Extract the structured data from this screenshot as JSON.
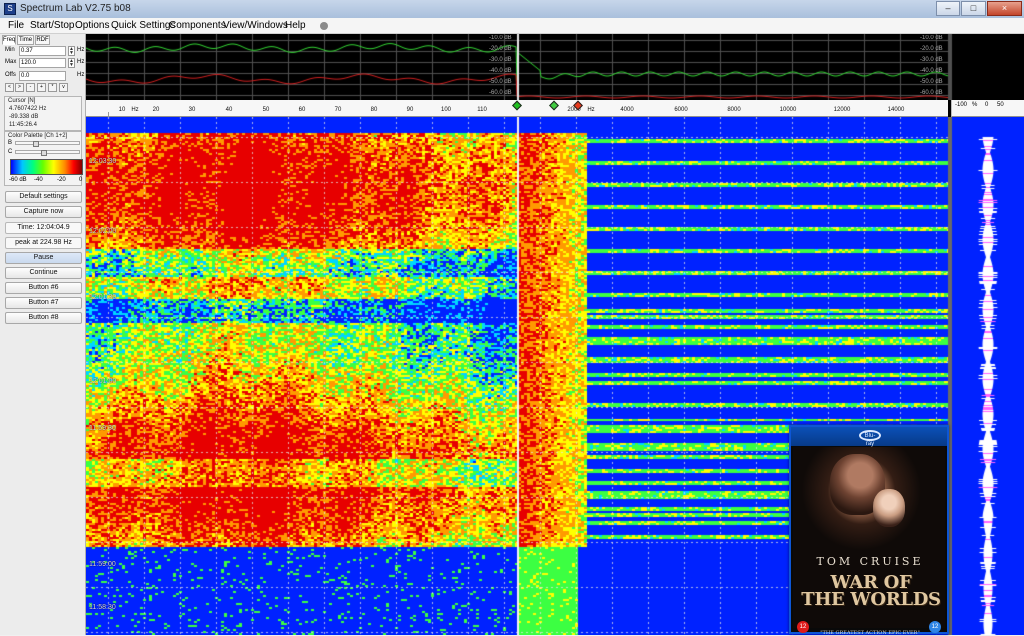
{
  "window": {
    "title": "Spectrum Lab V2.75 b08",
    "buttons": {
      "minimize": "–",
      "maximize": "□",
      "close": "×"
    }
  },
  "menu": {
    "items": [
      "File",
      "Start/Stop",
      "Options",
      "Quick Settings",
      "Components",
      "View/Windows",
      "Help"
    ]
  },
  "left_panel": {
    "tabs": [
      "Freq",
      "Time",
      "RDF"
    ],
    "min_label": "Min",
    "min_value": "0.37",
    "max_label": "Max",
    "max_value": "120.0",
    "offset_label": "Offs",
    "offset_value": "0.0",
    "unit_hz": "Hz",
    "small_buttons": [
      "<",
      ">",
      "-",
      "+",
      "*",
      "v"
    ],
    "cursor": {
      "title": "Cursor [N]",
      "frequency": "4.7607422 Hz",
      "level": "-89.338 dB",
      "time": "11:45:26.4"
    },
    "palette": {
      "title": "Color Palette [Ch 1+2]",
      "b_label": "B",
      "c_label": "C",
      "scale": [
        "-60 dB",
        "-40",
        "-20",
        "0"
      ],
      "b_slider_level": 0.28,
      "c_slider_level": 0.43
    },
    "buttons": {
      "default_settings": "Default settings",
      "capture_now": "Capture now",
      "time": "Time:  12:04:04.9",
      "peak": "peak at 224.98 Hz",
      "pause": "Pause",
      "continue": "Continue",
      "button6": "Button #6",
      "button7": "Button #7",
      "button8": "Button #8"
    }
  },
  "spectrum": {
    "db_labels": [
      "-10.0 dB",
      "-20.0 dB",
      "-30.0 dB",
      "-40.0 dB",
      "-50.0 dB",
      "-60.0 dB"
    ],
    "low_ticks": [
      "10",
      "20",
      "30",
      "40",
      "50",
      "60",
      "70",
      "80",
      "90",
      "100",
      "110"
    ],
    "low_ticks_hz": "Hz",
    "high_ticks": [
      "2000",
      "4000",
      "6000",
      "8000",
      "10000",
      "12000",
      "14000"
    ],
    "high_ticks_hz": "Hz",
    "right_axis": [
      "-100",
      "%",
      "0",
      "50"
    ],
    "colors": {
      "background": "#000000",
      "green_trace": "#34d834",
      "red_trace": "#d32020",
      "grid": "#d5d5d5"
    }
  },
  "waterfall": {
    "timestamps": [
      "12:03:30",
      "12:02:00",
      "12:01:30",
      "12:01:00",
      "11:59:30",
      "11:59:00",
      "11:58:30"
    ],
    "colors": {
      "blue": "#0022ff",
      "cyan": "#00d6ff",
      "green": "#3cff42",
      "yellow": "#ffff00",
      "orange": "#ff9a00",
      "red": "#e70000"
    }
  },
  "poster": {
    "logo": "Blu-ray",
    "actor": "TOM CRUISE",
    "title_line1": "WAR OF",
    "title_line2": "THE WORLDS",
    "quote": "\"THE GREATEST ACTION EPIC EVER\"",
    "rating_left": "12",
    "rating_right": "12"
  }
}
